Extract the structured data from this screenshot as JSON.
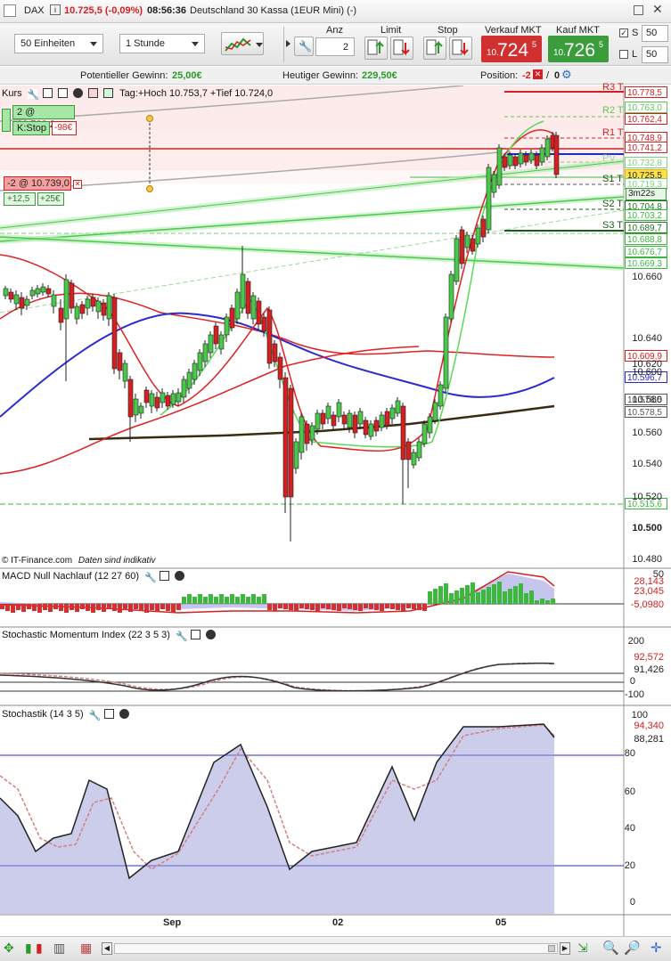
{
  "titlebar": {
    "symbol": "DAX",
    "price": "10.725,5 (-0,09%)",
    "time": "08:56:36",
    "instrument": "Deutschland 30 Kassa (1EUR Mini) (-)"
  },
  "toolbar": {
    "units": "50 Einheiten",
    "interval": "1 Stunde",
    "anz_label": "Anz",
    "anz_value": "2",
    "limit_label": "Limit",
    "stop_label": "Stop",
    "sell_label": "Verkauf MKT",
    "buy_label": "Kauf MKT",
    "sell_prefix": "10.",
    "sell_main": "724",
    "sell_suffix": "5",
    "buy_prefix": "10.",
    "buy_main": "726",
    "buy_suffix": "5",
    "s_label": "S",
    "s_value": "50",
    "l_label": "L",
    "l_value": "50"
  },
  "infobar": {
    "potential_label": "Potentieller Gewinn:",
    "potential_value": "25,00€",
    "today_label": "Heutiger Gewinn:",
    "today_value": "229,50€",
    "position_label": "Position:",
    "position_value": "-2",
    "position_sep": "/",
    "position_zero": "0"
  },
  "main_panel": {
    "title": "Kurs",
    "info": "Tag:+Hoch 10.753,7 +Tief 10.724,0",
    "order1": "2 @ 10.788,2",
    "kstop": "K:Stop",
    "kstop_value": "-98€",
    "pos_label": "-2 @ 10.739,0",
    "gain1": "+12,5",
    "gain2": "+25€",
    "footer": "© IT-Finance.com",
    "footer2": "Daten sind indikativ",
    "timer": "3m22s"
  },
  "pivot_labels": {
    "r3": "R3 T",
    "r2": "R2 T",
    "r1": "R1 T",
    "pv": "PV",
    "s1": "S1 T",
    "s2": "S2 T",
    "s3": "S3 T"
  },
  "price_axis": [
    "10.660",
    "10.640",
    "10.620",
    "10.600",
    "10.580",
    "10.560",
    "10.540",
    "10.520",
    "10.500",
    "10.480"
  ],
  "price_tags": [
    {
      "v": "10.778,5",
      "c": "#d42020"
    },
    {
      "v": "10.763,0",
      "c": "#5ac85a"
    },
    {
      "v": "10.762,4",
      "c": "#d42020"
    },
    {
      "v": "10.748,9",
      "c": "#d42020"
    },
    {
      "v": "10.741,2",
      "c": "#d42020"
    },
    {
      "v": "10.732,8",
      "c": "#7ccf7c"
    },
    {
      "v": "10.725,5",
      "c": "#e8b800"
    },
    {
      "v": "10.719,3",
      "c": "#7ccf7c"
    },
    {
      "v": "10.704,8",
      "c": "#1a7a1a"
    },
    {
      "v": "10.703,2",
      "c": "#3cb83c"
    },
    {
      "v": "10.689,7",
      "c": "#1a7a1a"
    },
    {
      "v": "10.688,8",
      "c": "#3cb83c"
    },
    {
      "v": "10.676,7",
      "c": "#3cb83c"
    },
    {
      "v": "10.669,3",
      "c": "#3cb83c"
    },
    {
      "v": "10.609,9",
      "c": "#d42020"
    },
    {
      "v": "10.596,7",
      "c": "#2a2ad0"
    },
    {
      "v": "10.578,5",
      "c": "#555"
    },
    {
      "v": "10.578,5",
      "c": "#555"
    },
    {
      "v": "10.515,6",
      "c": "#3cb83c"
    }
  ],
  "macd": {
    "title": "MACD Null Nachlauf (12 27 60)",
    "axis_top": "50",
    "v1": "28,143",
    "v2": "23,045",
    "v3": "-5,0980"
  },
  "smi": {
    "title": "Stochastic Momentum Index (22 3 5 3)",
    "axis": [
      "200",
      "100",
      "0",
      "-100"
    ],
    "v1": "92,572",
    "v2": "91,426"
  },
  "stoch": {
    "title": "Stochastik (14 3 5)",
    "axis": [
      "100",
      "80",
      "60",
      "40",
      "20",
      "0"
    ],
    "v1": "94,340",
    "v2": "88,281"
  },
  "x_axis": [
    "Sep",
    "02",
    "05"
  ]
}
